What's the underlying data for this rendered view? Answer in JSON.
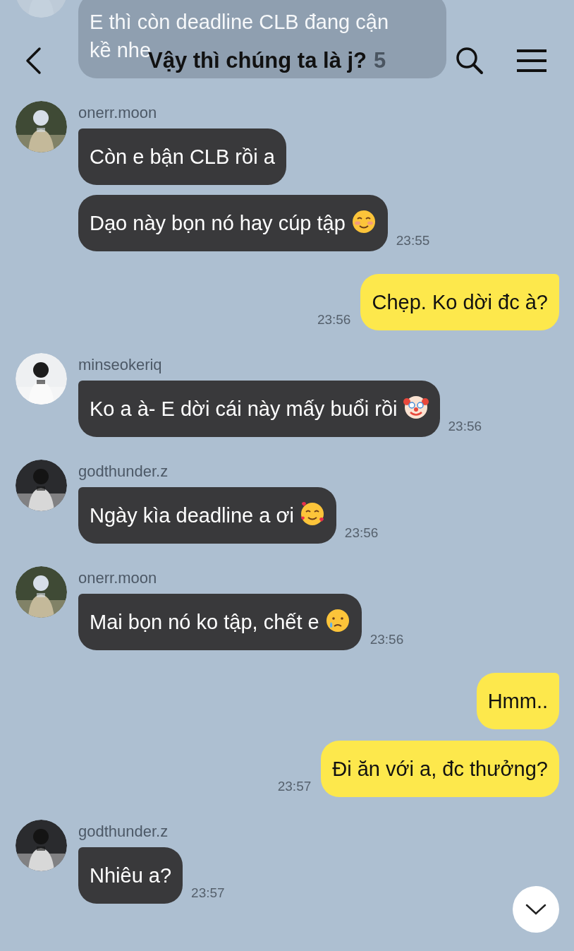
{
  "header": {
    "title": "Vậy thì chúng ta là j?",
    "member_count": "5"
  },
  "messages": [
    {
      "kind": "incoming",
      "faded": true,
      "bubbles": [
        {
          "kind": "plain",
          "text": "E thì còn deadline CLB đang cận kề nhe"
        }
      ]
    },
    {
      "kind": "incoming",
      "faded": false,
      "sender": "onerr.moon",
      "time": "23:55",
      "bubbles": [
        {
          "kind": "plain",
          "text": "Còn e bận CLB rồi a"
        },
        {
          "kind": "smiling",
          "text": "Dạo này bọn nó hay cúp tập"
        }
      ]
    },
    {
      "kind": "outgoing",
      "faded": false,
      "time": "23:56",
      "bubbles": [
        {
          "kind": "plain",
          "text": "Chẹp. Ko dời đc à?"
        }
      ]
    },
    {
      "kind": "incoming",
      "faded": false,
      "sender": "minseokeriq",
      "time": "23:56",
      "bubbles": [
        {
          "kind": "clown",
          "text": "Ko a à- E dời cái này mấy buổi rồi"
        }
      ]
    },
    {
      "kind": "incoming",
      "faded": false,
      "sender": "godthunder.z",
      "time": "23:56",
      "bubbles": [
        {
          "kind": "hearts",
          "text": "Ngày kìa deadline a ơi"
        }
      ]
    },
    {
      "kind": "incoming",
      "faded": false,
      "sender": "onerr.moon",
      "time": "23:56",
      "bubbles": [
        {
          "kind": "tear",
          "text": "Mai bọn nó ko tập, chết e"
        }
      ]
    },
    {
      "kind": "outgoing",
      "faded": false,
      "time": "23:57",
      "bubbles": [
        {
          "kind": "plain",
          "text": "Hmm.."
        },
        {
          "kind": "plain",
          "text": "Đi ăn với a, đc thưởng?"
        }
      ]
    },
    {
      "kind": "incoming",
      "faded": false,
      "sender": "godthunder.z",
      "time": "23:57",
      "bubbles": [
        {
          "kind": "plain",
          "text": "Nhiêu a?"
        }
      ]
    }
  ]
}
